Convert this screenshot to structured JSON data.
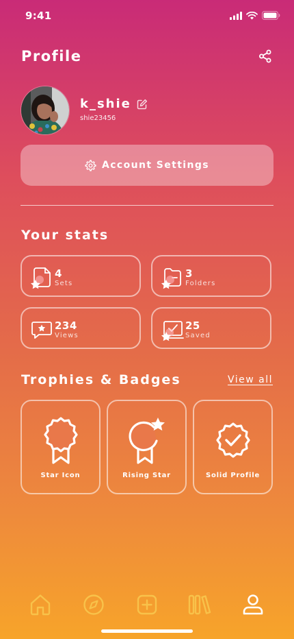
{
  "status_bar": {
    "time": "9:41"
  },
  "header": {
    "title": "Profile"
  },
  "profile": {
    "username": "k_shie",
    "handle": "shie23456"
  },
  "account_settings": {
    "label": "Account Settings"
  },
  "stats": {
    "title": "Your stats",
    "items": [
      {
        "value": "4",
        "label": "Sets",
        "icon": "sets-icon"
      },
      {
        "value": "3",
        "label": "Folders",
        "icon": "folder-icon"
      },
      {
        "value": "234",
        "label": "Views",
        "icon": "views-icon"
      },
      {
        "value": "25",
        "label": "Saved",
        "icon": "saved-icon"
      }
    ]
  },
  "trophies": {
    "title": "Trophies & Badges",
    "view_all": "View all",
    "badges": [
      {
        "label": "Star Icon"
      },
      {
        "label": "Rising Star"
      },
      {
        "label": "Solid Profile"
      }
    ]
  },
  "nav": {
    "items": [
      "home-icon",
      "explore-icon",
      "add-icon",
      "library-icon",
      "profile-icon"
    ],
    "active": "profile-icon",
    "active_color": "#ffffff",
    "inactive_color": "#f8c24a"
  },
  "colors": {
    "gradient_top": "#c92b77",
    "gradient_bottom": "#f7a42a"
  }
}
